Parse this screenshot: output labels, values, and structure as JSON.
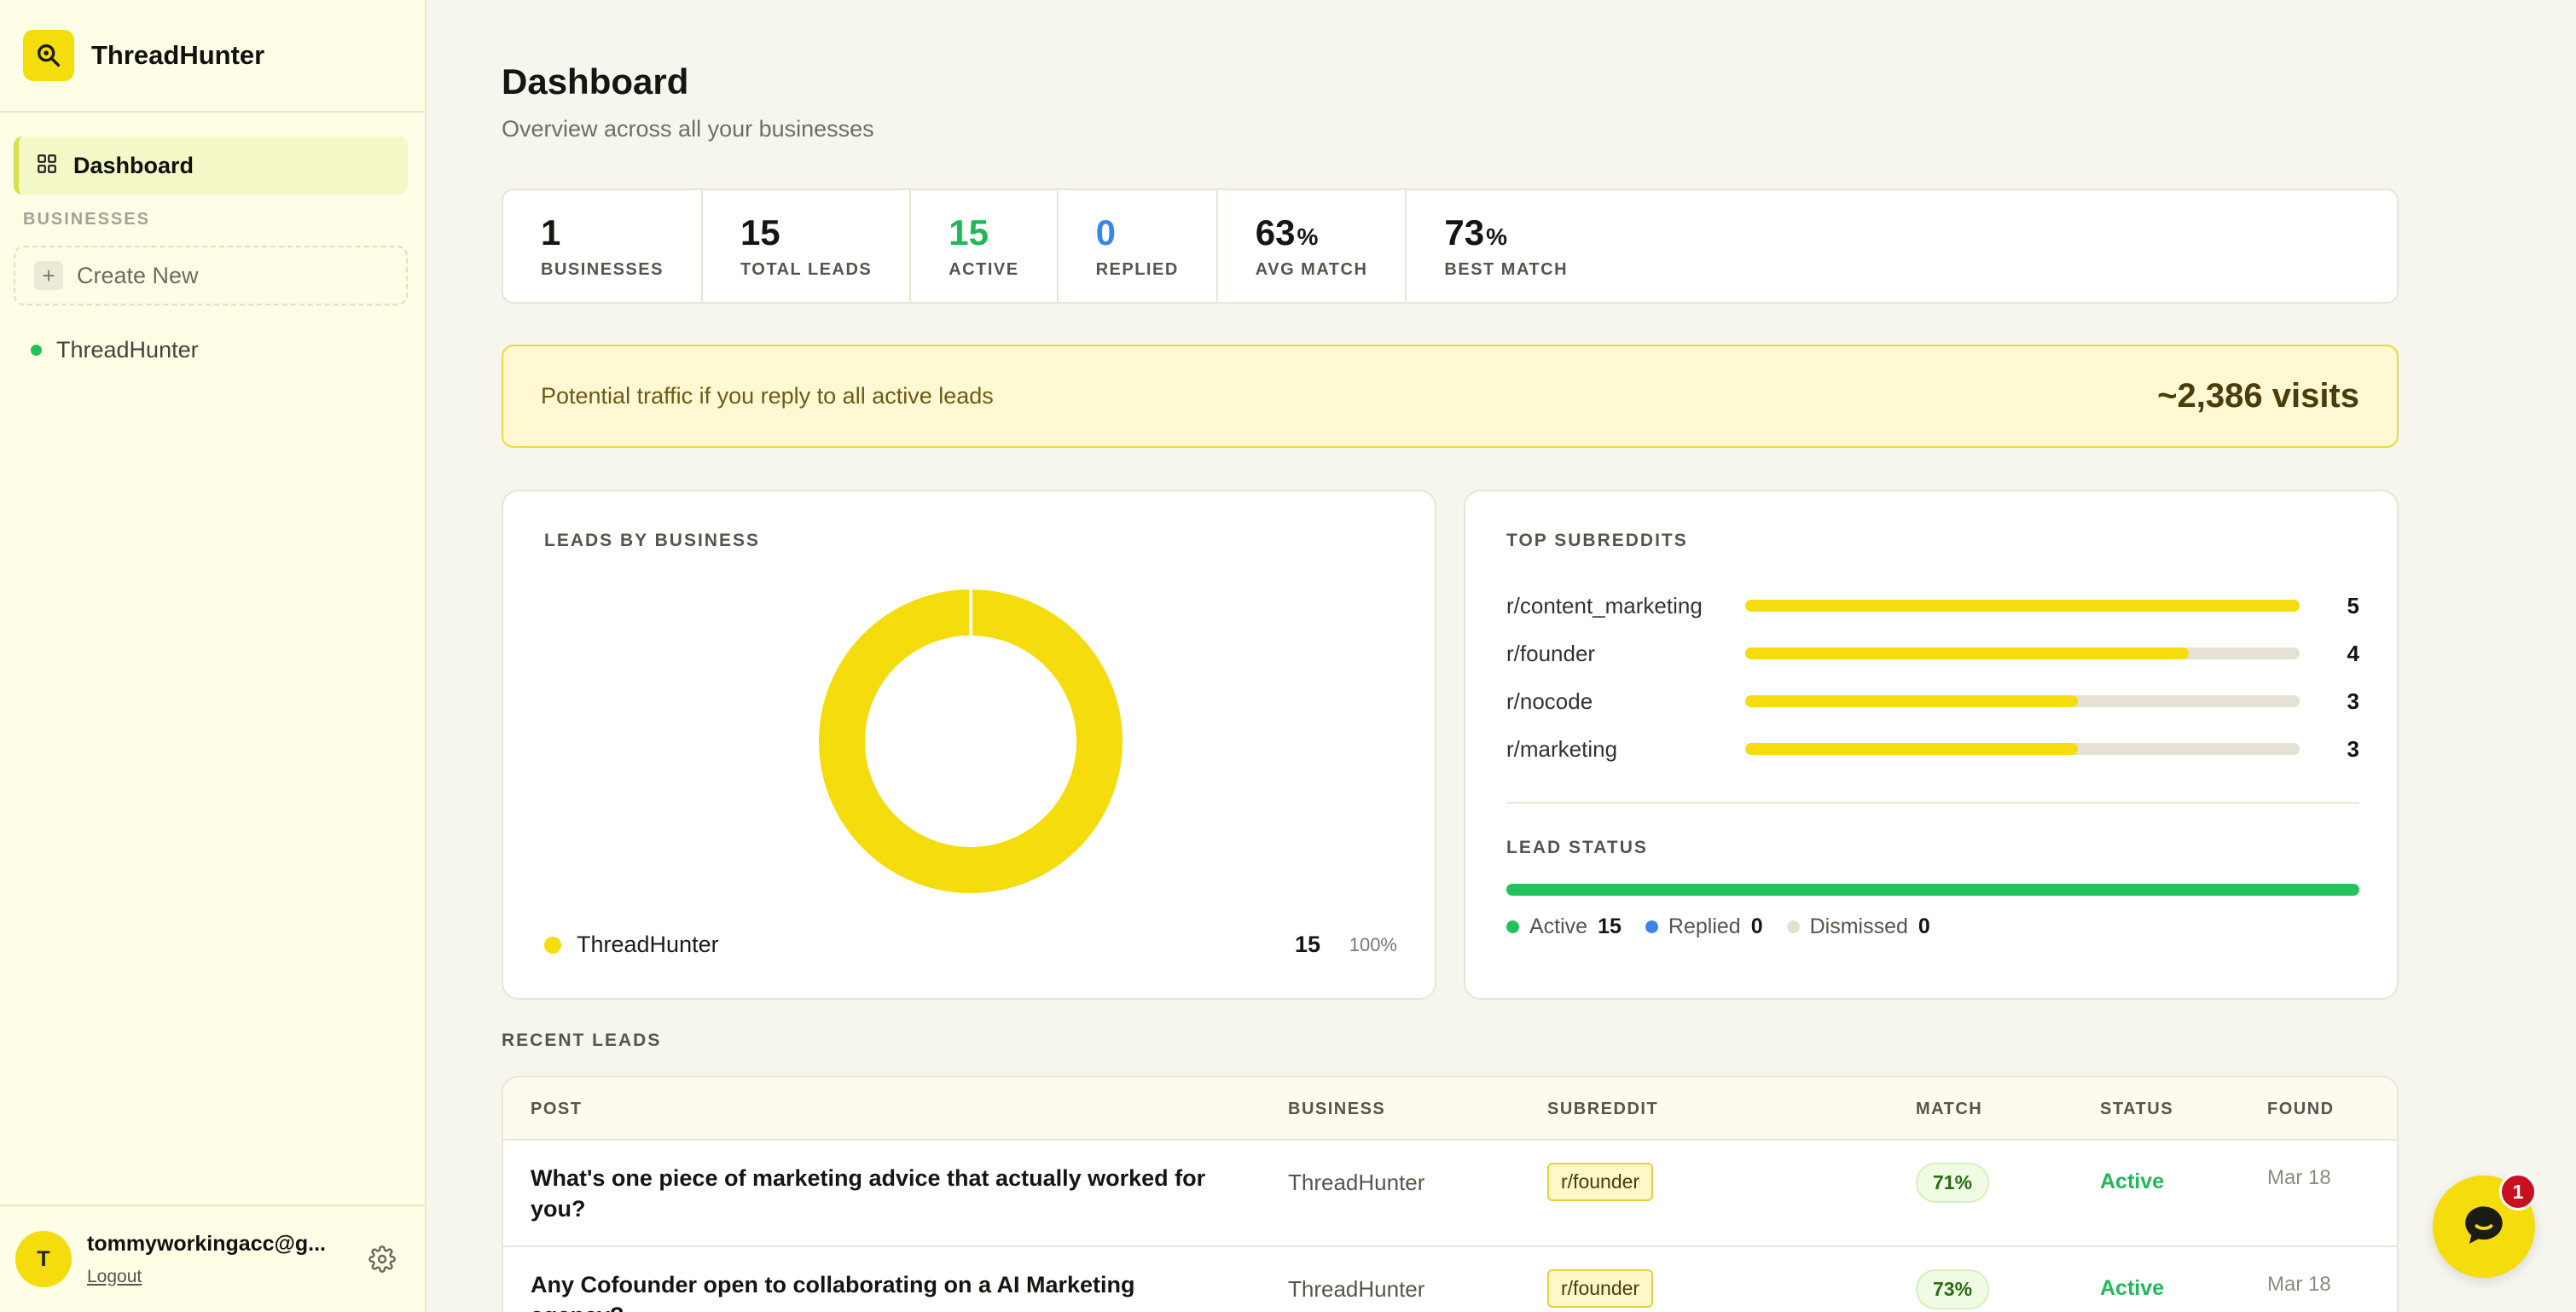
{
  "brand": {
    "name": "ThreadHunter"
  },
  "sidebar": {
    "nav_dashboard": "Dashboard",
    "section_label": "BUSINESSES",
    "create_new": "Create New",
    "businesses": [
      {
        "name": "ThreadHunter",
        "status_color": "#21c35a"
      }
    ],
    "user": {
      "initial": "T",
      "email": "tommyworkingacc@g...",
      "logout": "Logout"
    }
  },
  "header": {
    "title": "Dashboard",
    "subtitle": "Overview across all your businesses"
  },
  "stats": [
    {
      "value": "1",
      "suffix": "",
      "label": "BUSINESSES",
      "color": "default"
    },
    {
      "value": "15",
      "suffix": "",
      "label": "TOTAL LEADS",
      "color": "default"
    },
    {
      "value": "15",
      "suffix": "",
      "label": "ACTIVE",
      "color": "green"
    },
    {
      "value": "0",
      "suffix": "",
      "label": "REPLIED",
      "color": "blue"
    },
    {
      "value": "63",
      "suffix": "%",
      "label": "AVG MATCH",
      "color": "default"
    },
    {
      "value": "73",
      "suffix": "%",
      "label": "BEST MATCH",
      "color": "default"
    }
  ],
  "traffic": {
    "label": "Potential traffic if you reply to all active leads",
    "value": "~2,386 visits"
  },
  "leads_by_business": {
    "title": "LEADS BY BUSINESS",
    "chart_data": {
      "type": "pie",
      "categories": [
        "ThreadHunter"
      ],
      "values": [
        15
      ],
      "percents": [
        "100%"
      ],
      "colors": [
        "#f5dc0c"
      ]
    }
  },
  "top_subreddits": {
    "title": "TOP SUBREDDITS",
    "chart_data": {
      "type": "bar",
      "categories": [
        "r/content_marketing",
        "r/founder",
        "r/nocode",
        "r/marketing"
      ],
      "values": [
        5,
        4,
        3,
        3
      ],
      "max": 5
    }
  },
  "lead_status": {
    "title": "LEAD STATUS",
    "items": [
      {
        "label": "Active",
        "count": "15",
        "value": 15,
        "color": "#21c35a"
      },
      {
        "label": "Replied",
        "count": "0",
        "value": 0,
        "color": "#3a86e8"
      },
      {
        "label": "Dismissed",
        "count": "0",
        "value": 0,
        "color": "#e3e0cf"
      }
    ]
  },
  "recent_leads": {
    "title": "RECENT LEADS",
    "columns": [
      "POST",
      "BUSINESS",
      "SUBREDDIT",
      "MATCH",
      "STATUS",
      "FOUND"
    ],
    "rows": [
      {
        "post": "What's one piece of marketing advice that actually worked for you?",
        "business": "ThreadHunter",
        "subreddit": "r/founder",
        "match": "71%",
        "status": "Active",
        "found": "Mar 18"
      },
      {
        "post": "Any Cofounder open to collaborating on a AI Marketing agency?",
        "business": "ThreadHunter",
        "subreddit": "r/founder",
        "match": "73%",
        "status": "Active",
        "found": "Mar 18"
      }
    ]
  },
  "chat": {
    "badge": "1"
  }
}
